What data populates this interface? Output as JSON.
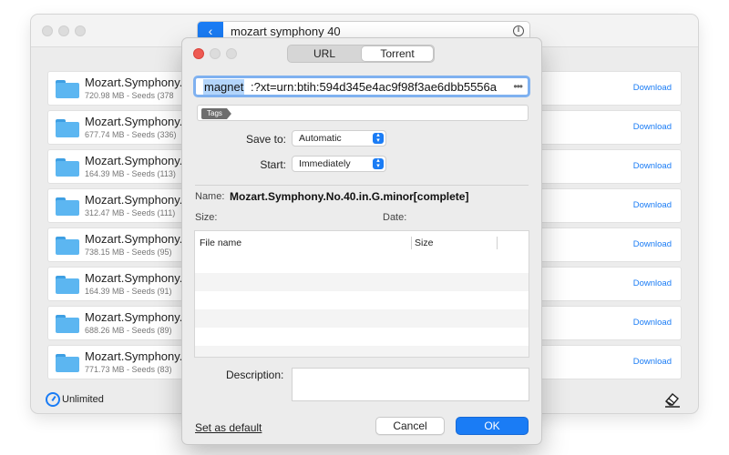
{
  "main_window": {
    "search_query": "mozart symphony 40",
    "results": [
      {
        "title": "Mozart.Symphony.",
        "sub": "720.98 MB - Seeds (378",
        "action": "Download"
      },
      {
        "title": "Mozart.Symphony.",
        "sub": "677.74 MB - Seeds (336)",
        "action": "Download"
      },
      {
        "title": "Mozart.Symphony.",
        "sub": "164.39 MB - Seeds (113)",
        "action": "Download"
      },
      {
        "title": "Mozart.Symphony.",
        "sub": "312.47 MB - Seeds (111)",
        "action": "Download"
      },
      {
        "title": "Mozart.Symphony.",
        "sub": "738.15 MB - Seeds (95)",
        "action": "Download"
      },
      {
        "title": "Mozart.Symphony.",
        "sub": "164.39 MB - Seeds (91)",
        "action": "Download"
      },
      {
        "title": "Mozart.Symphony.",
        "sub": "688.26 MB - Seeds (89)",
        "action": "Download"
      },
      {
        "title": "Mozart.Symphony.",
        "sub": "771.73 MB - Seeds (83)",
        "action": "Download"
      }
    ],
    "speed_limit": "Unlimited",
    "icons": {
      "back": "chevron-left-icon",
      "pause": "pause-icon",
      "folder": "folder-icon",
      "gauge": "gauge-icon",
      "eraser": "eraser-icon"
    },
    "accent_color": "#1a7cf5"
  },
  "dialog": {
    "tabs": [
      {
        "label": "URL",
        "active": false
      },
      {
        "label": "Torrent",
        "active": true
      }
    ],
    "magnet_selected": "magnet",
    "magnet_rest": ":?xt=urn:btih:594d345e4ac9f98f3ae6dbb5556a",
    "tags_chip": "Tags",
    "save_to_label": "Save to:",
    "save_to_value": "Automatic",
    "start_label": "Start:",
    "start_value": "Immediately",
    "name_label": "Name:",
    "name_value": "Mozart.Symphony.No.40.in.G.minor[complete]",
    "size_label": "Size:",
    "date_label": "Date:",
    "table_columns": [
      "File name",
      "Size"
    ],
    "description_label": "Description:",
    "set_default_label": "Set as default",
    "cancel_label": "Cancel",
    "ok_label": "OK"
  }
}
